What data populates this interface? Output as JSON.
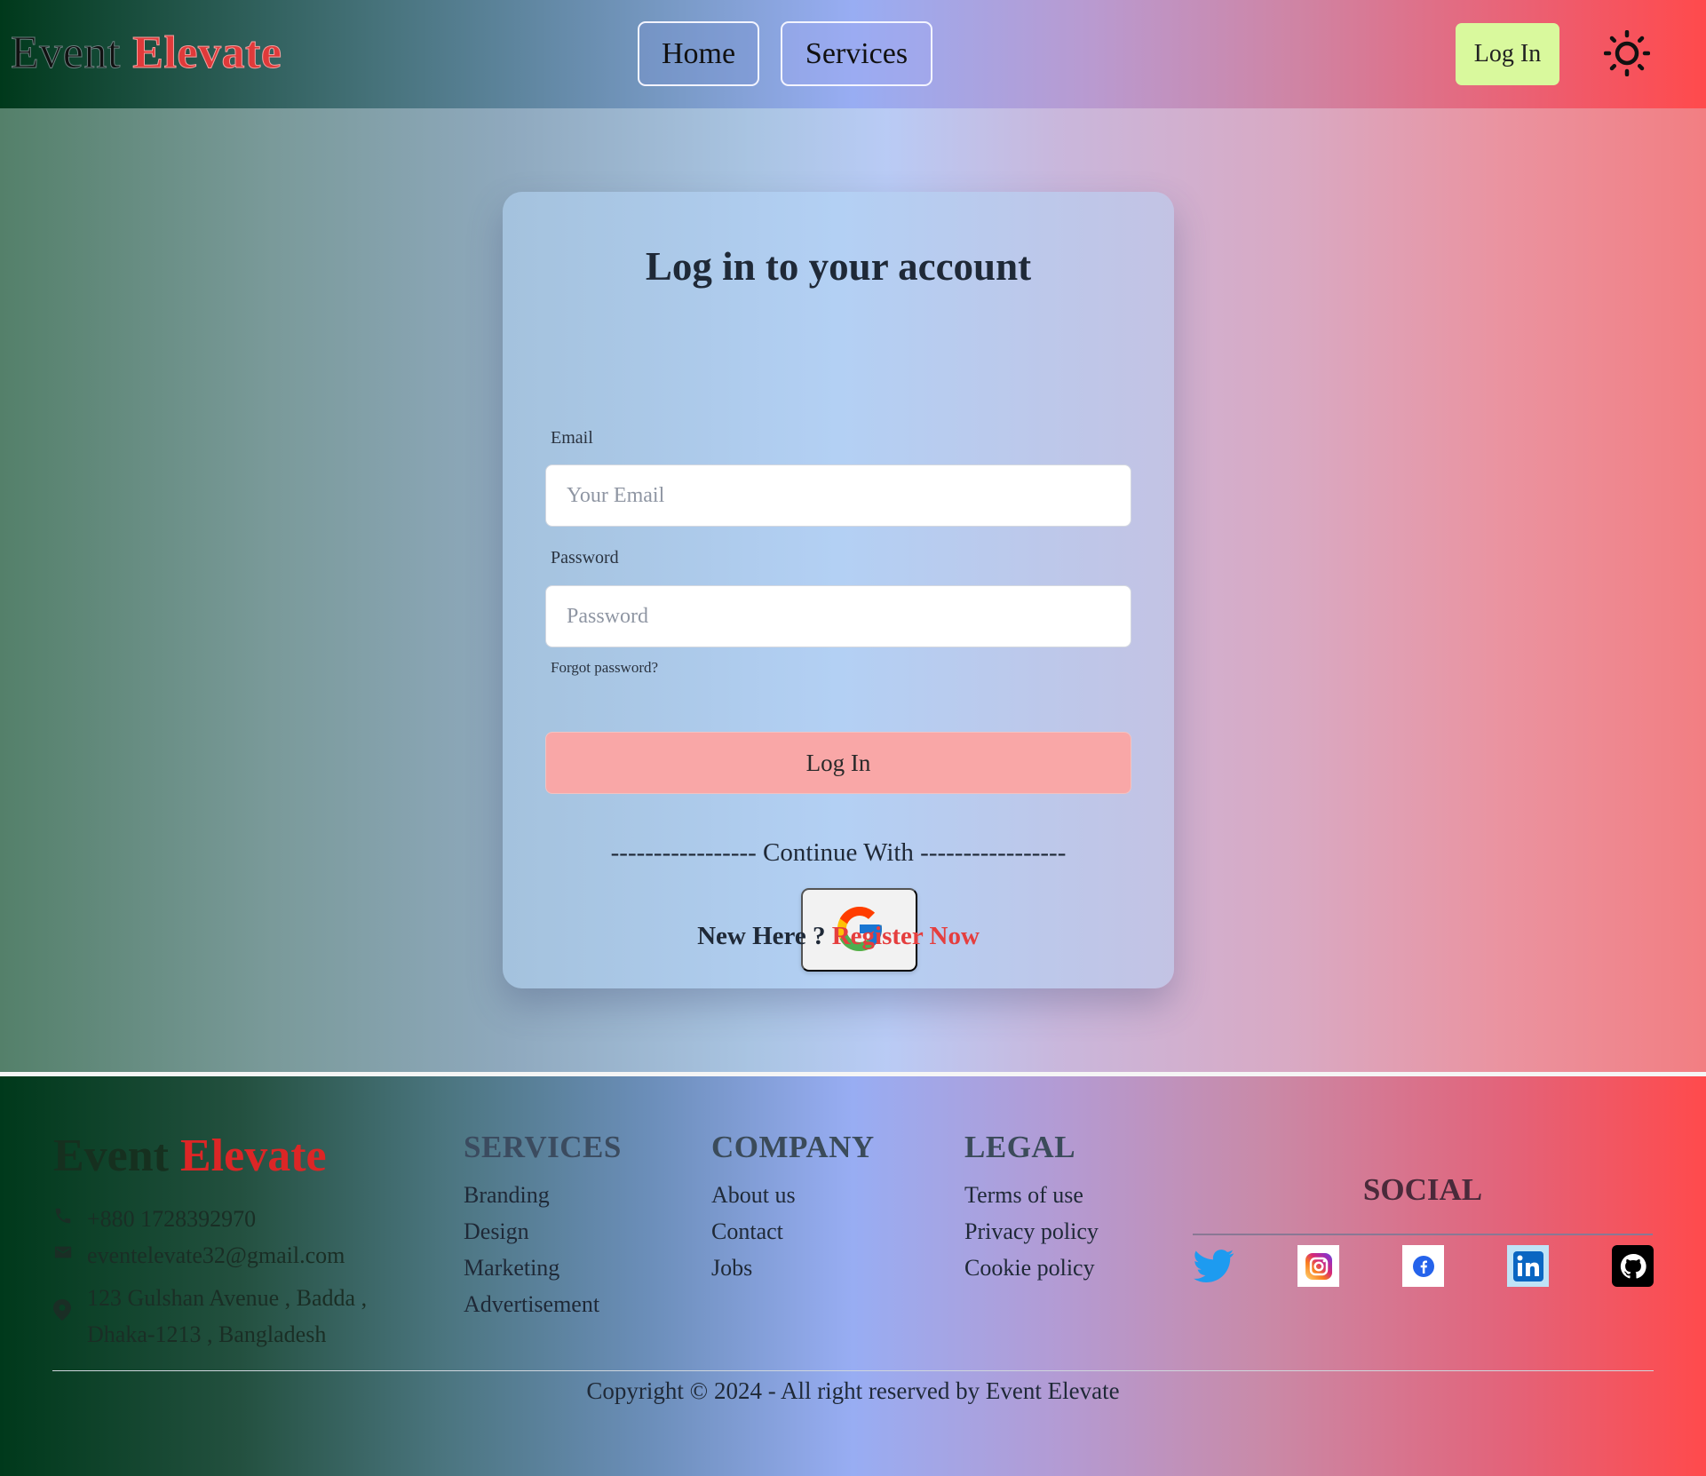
{
  "brand": {
    "part1": "Event",
    "part2": "Elevate"
  },
  "nav": {
    "home": "Home",
    "services": "Services",
    "login": "Log In",
    "theme_icon": "sun-icon"
  },
  "login_form": {
    "title": "Log in to your account",
    "email_label": "Email",
    "email_placeholder": "Your Email",
    "email_value": "",
    "password_label": "Password",
    "password_placeholder": "Password",
    "password_value": "",
    "forgot": "Forgot password?",
    "submit": "Log In",
    "continue_with": "----------------- Continue With -----------------",
    "google_icon": "google-icon",
    "new_here": "New Here ?",
    "register": "Register Now"
  },
  "footer": {
    "contact": {
      "phone": "+880 1728392970",
      "email": "eventelevate32@gmail.com",
      "address": "123 Gulshan Avenue , Badda , Dhaka-1213 , Bangladesh"
    },
    "services": {
      "heading": "SERVICES",
      "links": [
        "Branding",
        "Design",
        "Marketing",
        "Advertisement"
      ]
    },
    "company": {
      "heading": "COMPANY",
      "links": [
        "About us",
        "Contact",
        "Jobs"
      ]
    },
    "legal": {
      "heading": "LEGAL",
      "links": [
        "Terms of use",
        "Privacy policy",
        "Cookie policy"
      ]
    },
    "social": {
      "heading": "SOCIAL",
      "icons": [
        "twitter-icon",
        "instagram-icon",
        "facebook-icon",
        "linkedin-icon",
        "github-icon"
      ]
    },
    "copyright": "Copyright © 2024 - All right reserved by Event Elevate"
  },
  "colors": {
    "brand_red": "#dc2626",
    "login_button": "#f9a7a7",
    "top_login_button": "#d9f99d",
    "register_link": "#e53e3e"
  }
}
